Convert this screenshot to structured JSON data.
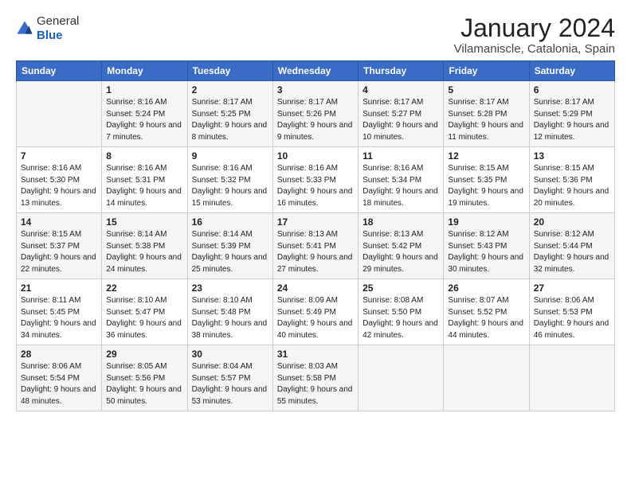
{
  "logo": {
    "general": "General",
    "blue": "Blue"
  },
  "title": "January 2024",
  "subtitle": "Vilamaniscle, Catalonia, Spain",
  "headers": [
    "Sunday",
    "Monday",
    "Tuesday",
    "Wednesday",
    "Thursday",
    "Friday",
    "Saturday"
  ],
  "weeks": [
    [
      {
        "day": "",
        "sunrise": "",
        "sunset": "",
        "daylight": ""
      },
      {
        "day": "1",
        "sunrise": "Sunrise: 8:16 AM",
        "sunset": "Sunset: 5:24 PM",
        "daylight": "Daylight: 9 hours and 7 minutes."
      },
      {
        "day": "2",
        "sunrise": "Sunrise: 8:17 AM",
        "sunset": "Sunset: 5:25 PM",
        "daylight": "Daylight: 9 hours and 8 minutes."
      },
      {
        "day": "3",
        "sunrise": "Sunrise: 8:17 AM",
        "sunset": "Sunset: 5:26 PM",
        "daylight": "Daylight: 9 hours and 9 minutes."
      },
      {
        "day": "4",
        "sunrise": "Sunrise: 8:17 AM",
        "sunset": "Sunset: 5:27 PM",
        "daylight": "Daylight: 9 hours and 10 minutes."
      },
      {
        "day": "5",
        "sunrise": "Sunrise: 8:17 AM",
        "sunset": "Sunset: 5:28 PM",
        "daylight": "Daylight: 9 hours and 11 minutes."
      },
      {
        "day": "6",
        "sunrise": "Sunrise: 8:17 AM",
        "sunset": "Sunset: 5:29 PM",
        "daylight": "Daylight: 9 hours and 12 minutes."
      }
    ],
    [
      {
        "day": "7",
        "sunrise": "Sunrise: 8:16 AM",
        "sunset": "Sunset: 5:30 PM",
        "daylight": "Daylight: 9 hours and 13 minutes."
      },
      {
        "day": "8",
        "sunrise": "Sunrise: 8:16 AM",
        "sunset": "Sunset: 5:31 PM",
        "daylight": "Daylight: 9 hours and 14 minutes."
      },
      {
        "day": "9",
        "sunrise": "Sunrise: 8:16 AM",
        "sunset": "Sunset: 5:32 PM",
        "daylight": "Daylight: 9 hours and 15 minutes."
      },
      {
        "day": "10",
        "sunrise": "Sunrise: 8:16 AM",
        "sunset": "Sunset: 5:33 PM",
        "daylight": "Daylight: 9 hours and 16 minutes."
      },
      {
        "day": "11",
        "sunrise": "Sunrise: 8:16 AM",
        "sunset": "Sunset: 5:34 PM",
        "daylight": "Daylight: 9 hours and 18 minutes."
      },
      {
        "day": "12",
        "sunrise": "Sunrise: 8:15 AM",
        "sunset": "Sunset: 5:35 PM",
        "daylight": "Daylight: 9 hours and 19 minutes."
      },
      {
        "day": "13",
        "sunrise": "Sunrise: 8:15 AM",
        "sunset": "Sunset: 5:36 PM",
        "daylight": "Daylight: 9 hours and 20 minutes."
      }
    ],
    [
      {
        "day": "14",
        "sunrise": "Sunrise: 8:15 AM",
        "sunset": "Sunset: 5:37 PM",
        "daylight": "Daylight: 9 hours and 22 minutes."
      },
      {
        "day": "15",
        "sunrise": "Sunrise: 8:14 AM",
        "sunset": "Sunset: 5:38 PM",
        "daylight": "Daylight: 9 hours and 24 minutes."
      },
      {
        "day": "16",
        "sunrise": "Sunrise: 8:14 AM",
        "sunset": "Sunset: 5:39 PM",
        "daylight": "Daylight: 9 hours and 25 minutes."
      },
      {
        "day": "17",
        "sunrise": "Sunrise: 8:13 AM",
        "sunset": "Sunset: 5:41 PM",
        "daylight": "Daylight: 9 hours and 27 minutes."
      },
      {
        "day": "18",
        "sunrise": "Sunrise: 8:13 AM",
        "sunset": "Sunset: 5:42 PM",
        "daylight": "Daylight: 9 hours and 29 minutes."
      },
      {
        "day": "19",
        "sunrise": "Sunrise: 8:12 AM",
        "sunset": "Sunset: 5:43 PM",
        "daylight": "Daylight: 9 hours and 30 minutes."
      },
      {
        "day": "20",
        "sunrise": "Sunrise: 8:12 AM",
        "sunset": "Sunset: 5:44 PM",
        "daylight": "Daylight: 9 hours and 32 minutes."
      }
    ],
    [
      {
        "day": "21",
        "sunrise": "Sunrise: 8:11 AM",
        "sunset": "Sunset: 5:45 PM",
        "daylight": "Daylight: 9 hours and 34 minutes."
      },
      {
        "day": "22",
        "sunrise": "Sunrise: 8:10 AM",
        "sunset": "Sunset: 5:47 PM",
        "daylight": "Daylight: 9 hours and 36 minutes."
      },
      {
        "day": "23",
        "sunrise": "Sunrise: 8:10 AM",
        "sunset": "Sunset: 5:48 PM",
        "daylight": "Daylight: 9 hours and 38 minutes."
      },
      {
        "day": "24",
        "sunrise": "Sunrise: 8:09 AM",
        "sunset": "Sunset: 5:49 PM",
        "daylight": "Daylight: 9 hours and 40 minutes."
      },
      {
        "day": "25",
        "sunrise": "Sunrise: 8:08 AM",
        "sunset": "Sunset: 5:50 PM",
        "daylight": "Daylight: 9 hours and 42 minutes."
      },
      {
        "day": "26",
        "sunrise": "Sunrise: 8:07 AM",
        "sunset": "Sunset: 5:52 PM",
        "daylight": "Daylight: 9 hours and 44 minutes."
      },
      {
        "day": "27",
        "sunrise": "Sunrise: 8:06 AM",
        "sunset": "Sunset: 5:53 PM",
        "daylight": "Daylight: 9 hours and 46 minutes."
      }
    ],
    [
      {
        "day": "28",
        "sunrise": "Sunrise: 8:06 AM",
        "sunset": "Sunset: 5:54 PM",
        "daylight": "Daylight: 9 hours and 48 minutes."
      },
      {
        "day": "29",
        "sunrise": "Sunrise: 8:05 AM",
        "sunset": "Sunset: 5:56 PM",
        "daylight": "Daylight: 9 hours and 50 minutes."
      },
      {
        "day": "30",
        "sunrise": "Sunrise: 8:04 AM",
        "sunset": "Sunset: 5:57 PM",
        "daylight": "Daylight: 9 hours and 53 minutes."
      },
      {
        "day": "31",
        "sunrise": "Sunrise: 8:03 AM",
        "sunset": "Sunset: 5:58 PM",
        "daylight": "Daylight: 9 hours and 55 minutes."
      },
      {
        "day": "",
        "sunrise": "",
        "sunset": "",
        "daylight": ""
      },
      {
        "day": "",
        "sunrise": "",
        "sunset": "",
        "daylight": ""
      },
      {
        "day": "",
        "sunrise": "",
        "sunset": "",
        "daylight": ""
      }
    ]
  ]
}
